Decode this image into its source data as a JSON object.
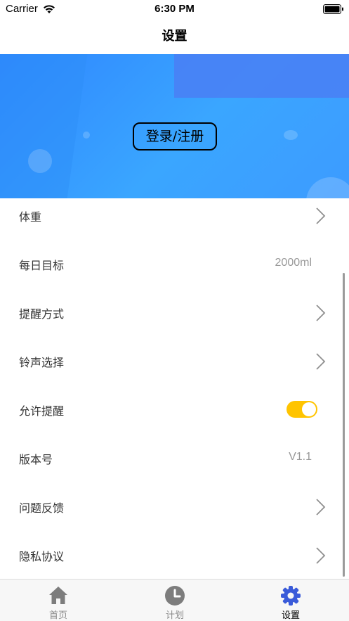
{
  "status_bar": {
    "carrier": "Carrier",
    "time": "6:30 PM"
  },
  "nav": {
    "title": "设置"
  },
  "banner": {
    "login_label": "登录/注册"
  },
  "settings": [
    {
      "label": "体重",
      "accessory": "chevron-right-icon"
    },
    {
      "label": "每日目标",
      "value": "2000ml"
    },
    {
      "label": "提醒方式",
      "accessory": "chevron-right-icon"
    },
    {
      "label": "铃声选择",
      "accessory": "chevron-right-icon"
    },
    {
      "label": "允许提醒",
      "toggle_on": true
    },
    {
      "label": "版本号",
      "value": "V1.1"
    },
    {
      "label": "问题反馈",
      "accessory": "chevron-right-icon"
    },
    {
      "label": "隐私协议",
      "accessory": "chevron-right-icon"
    }
  ],
  "tabs": [
    {
      "label": "首页",
      "icon": "home-icon",
      "active": false
    },
    {
      "label": "计划",
      "icon": "clock-icon",
      "active": false
    },
    {
      "label": "设置",
      "icon": "gear-icon",
      "active": true
    }
  ],
  "colors": {
    "accent": "#ffc400",
    "banner": "#3aa6ff",
    "tab_active": "#3a5bd9",
    "tab_inactive": "#8a8a8a"
  }
}
